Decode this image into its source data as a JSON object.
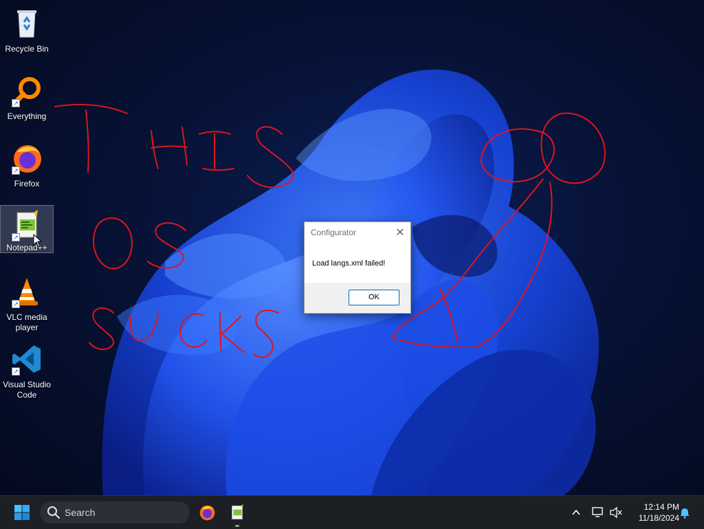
{
  "desktop": {
    "icons": [
      {
        "label": "Recycle Bin",
        "icon": "recycle-bin-icon",
        "shortcut": false
      },
      {
        "label": "Everything",
        "icon": "everything-search-icon",
        "shortcut": true
      },
      {
        "label": "Firefox",
        "icon": "firefox-icon",
        "shortcut": true
      },
      {
        "label": "Notepad++",
        "icon": "notepad-plus-plus-icon",
        "shortcut": true,
        "selected": true
      },
      {
        "label": "VLC media player",
        "icon": "vlc-cone-icon",
        "shortcut": true
      },
      {
        "label": "Visual Studio Code",
        "icon": "vscode-icon",
        "shortcut": true
      }
    ],
    "shortcut_arrow": "↗",
    "scribble_color": "#e0141e"
  },
  "dialog": {
    "title": "Configurator",
    "close_glyph": "✕",
    "message": "Load langs.xml failed!",
    "ok_label": "OK"
  },
  "taskbar": {
    "search_label": "Search",
    "apps": [
      "firefox-icon",
      "notepad-plus-plus-icon"
    ],
    "tray_chevron": "^",
    "time": "12:14 PM",
    "date": "11/18/2024",
    "accent": "#0078d4"
  }
}
